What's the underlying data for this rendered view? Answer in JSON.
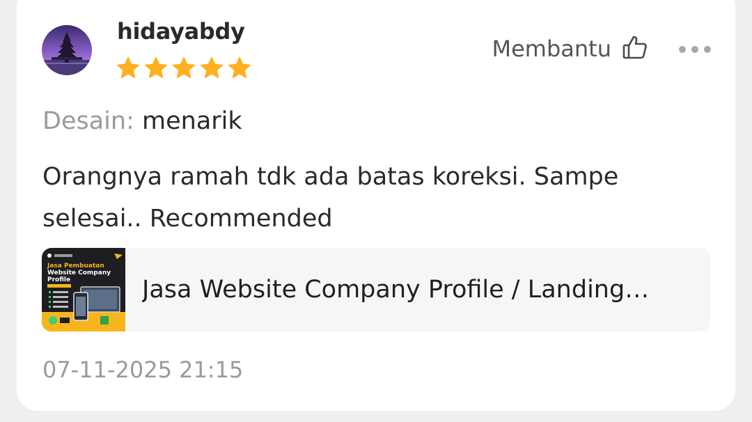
{
  "review": {
    "username": "hidayabdy",
    "rating": 5,
    "rating_max": 5,
    "star_color": "#ffb020",
    "helpful_label": "Membantu",
    "helpful_icon": "thumbs-up-icon",
    "more_icon": "more-options-icon",
    "attribute": {
      "key": "Desain:",
      "value": "menarik"
    },
    "text": "Orangnya ramah tdk ada batas koreksi. Sampe selesai.. Recommended",
    "product": {
      "title": "Jasa Website Company Profile / Landing…",
      "thumbnail_text": {
        "heading_line1": "Jasa Pembuatan",
        "heading_line2": "Website Company",
        "heading_line3": "Profile"
      }
    },
    "timestamp": "07-11-2025 21:15"
  }
}
